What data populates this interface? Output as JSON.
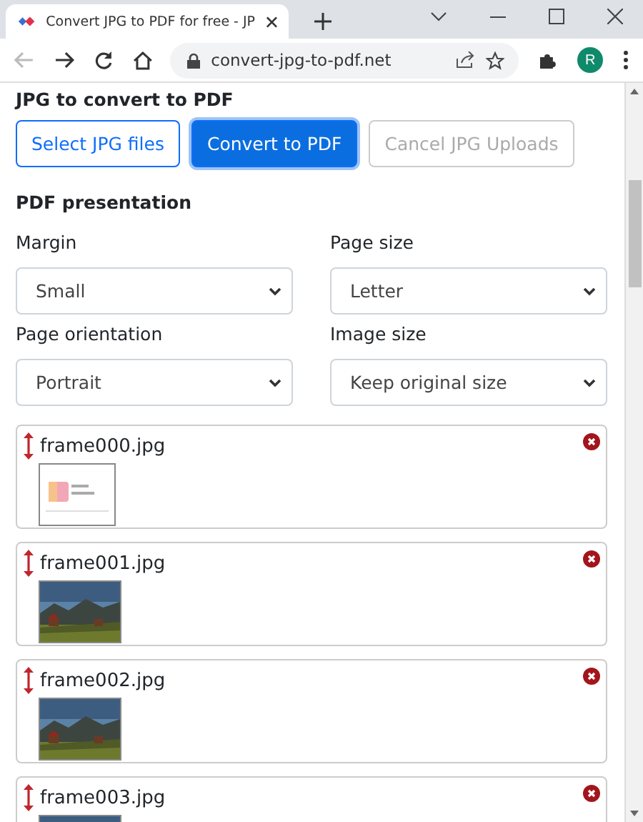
{
  "browser": {
    "tab_title": "Convert JPG to PDF for free - JP",
    "url": "convert-jpg-to-pdf.net",
    "profile_initial": "R"
  },
  "upload": {
    "heading": "JPG to convert to PDF",
    "buttons": [
      {
        "label": "Select JPG files",
        "kind": "outline",
        "disabled": false
      },
      {
        "label": "Convert to PDF",
        "kind": "primary",
        "disabled": false
      },
      {
        "label": "Cancel JPG Uploads",
        "kind": "outline",
        "disabled": true
      }
    ]
  },
  "presentation": {
    "heading": "PDF presentation",
    "fields": [
      {
        "label": "Margin",
        "value": "Small"
      },
      {
        "label": "Page size",
        "value": "Letter"
      },
      {
        "label": "Page orientation",
        "value": "Portrait"
      },
      {
        "label": "Image size",
        "value": "Keep original size"
      }
    ]
  },
  "files": [
    {
      "name": "frame000.jpg",
      "kind": "document"
    },
    {
      "name": "frame001.jpg"
    },
    {
      "name": "frame002.jpg"
    },
    {
      "name": "frame003.jpg"
    }
  ]
}
